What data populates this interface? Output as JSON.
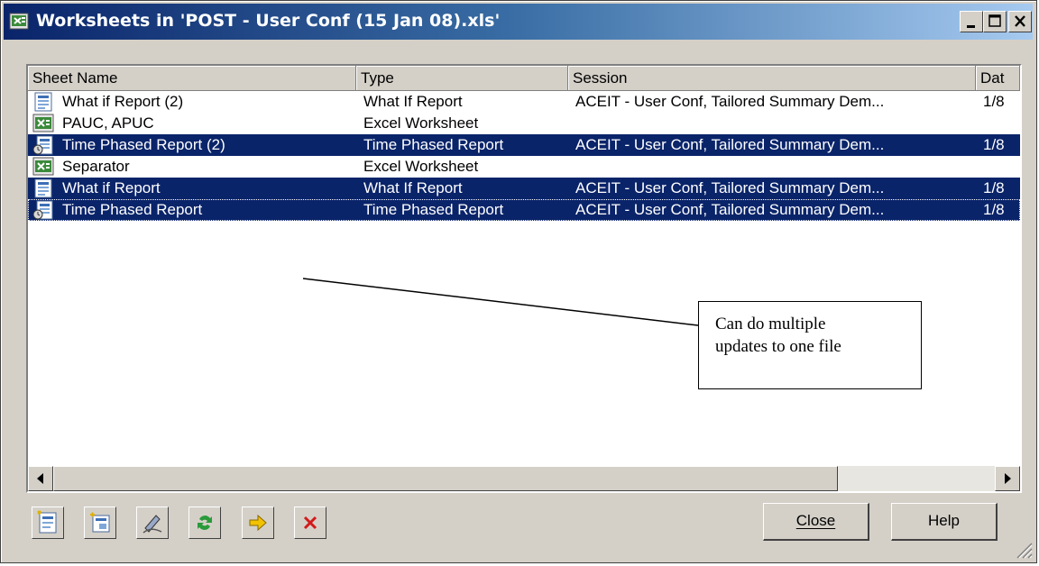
{
  "window": {
    "title": "Worksheets in 'POST - User Conf (15 Jan 08).xls'",
    "controls": [
      "minimize-icon",
      "maximize-icon",
      "close-icon"
    ]
  },
  "columns": [
    "Sheet Name",
    "Type",
    "Session",
    "Dat"
  ],
  "rows": [
    {
      "icon": "what-if-report-icon",
      "name": "What if Report (2)",
      "type": "What If Report",
      "session": "ACEIT - User Conf, Tailored Summary Dem...",
      "date": "1/8",
      "selected": false
    },
    {
      "icon": "excel-worksheet-icon",
      "name": "PAUC, APUC",
      "type": "Excel Worksheet",
      "session": "",
      "date": "",
      "selected": false
    },
    {
      "icon": "time-phased-report-icon",
      "name": "Time Phased Report (2)",
      "type": "Time Phased Report",
      "session": "ACEIT - User Conf, Tailored Summary Dem...",
      "date": "1/8",
      "selected": true
    },
    {
      "icon": "excel-worksheet-icon",
      "name": "Separator",
      "type": "Excel Worksheet",
      "session": "",
      "date": "",
      "selected": false
    },
    {
      "icon": "what-if-report-icon",
      "name": "What if Report",
      "type": "What If Report",
      "session": "ACEIT - User Conf, Tailored Summary Dem...",
      "date": "1/8",
      "selected": true
    },
    {
      "icon": "time-phased-report-icon",
      "name": "Time Phased Report",
      "type": "Time Phased Report",
      "session": "ACEIT - User Conf, Tailored Summary Dem...",
      "date": "1/8",
      "selected": true
    }
  ],
  "callout": {
    "line1": "Can do multiple",
    "line2": "updates to one file"
  },
  "toolbar": {
    "icons": [
      "new-sheet-icon",
      "insert-report-icon",
      "edit-icon",
      "refresh-icon",
      "move-icon",
      "delete-icon"
    ]
  },
  "buttons": {
    "close_label": "Close",
    "help_label": "Help"
  },
  "colors": {
    "titlebar_start": "#0a246a",
    "titlebar_end": "#a6caf0",
    "selection": "#0a246a",
    "face": "#d4d0c8"
  }
}
